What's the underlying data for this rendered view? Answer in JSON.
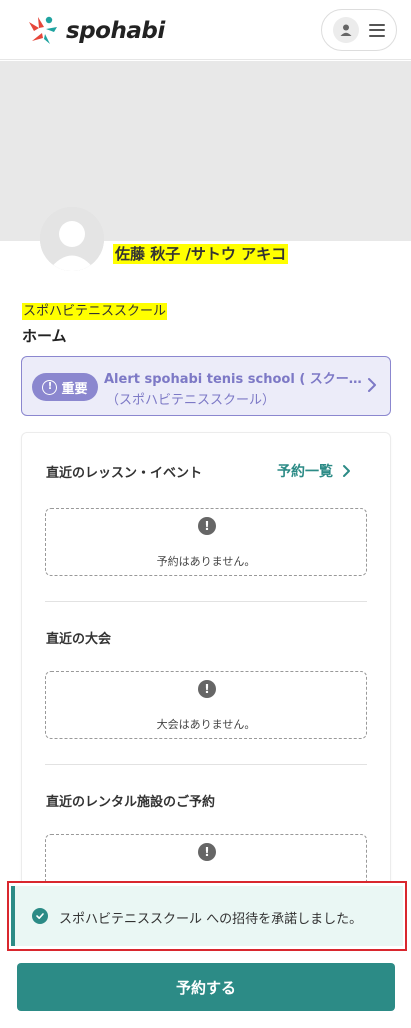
{
  "header": {
    "logo_text": "spohabi"
  },
  "profile": {
    "name": "佐藤 秋子 /サトウ アキコ"
  },
  "school": {
    "name": "スポハビテニススクール"
  },
  "page": {
    "title": "ホーム"
  },
  "alert": {
    "badge": "重要",
    "title": "Alert spohabi tenis school ( スクール… ",
    "subtitle": "（スポハビテニススクール）"
  },
  "sections": {
    "lessons": {
      "title": "直近のレッスン・イベント",
      "link": "予約一覧",
      "empty": "予約はありません。"
    },
    "tournaments": {
      "title": "直近の大会",
      "empty": "大会はありません。"
    },
    "rentals": {
      "title": "直近のレンタル施設のご予約"
    }
  },
  "toast": {
    "message": "スポハビテニススクール への招待を承諾しました。"
  },
  "cta": {
    "label": "予約する"
  },
  "colors": {
    "accent": "#2c8b86",
    "alert": "#8b87cf",
    "highlight": "#ffff00"
  }
}
